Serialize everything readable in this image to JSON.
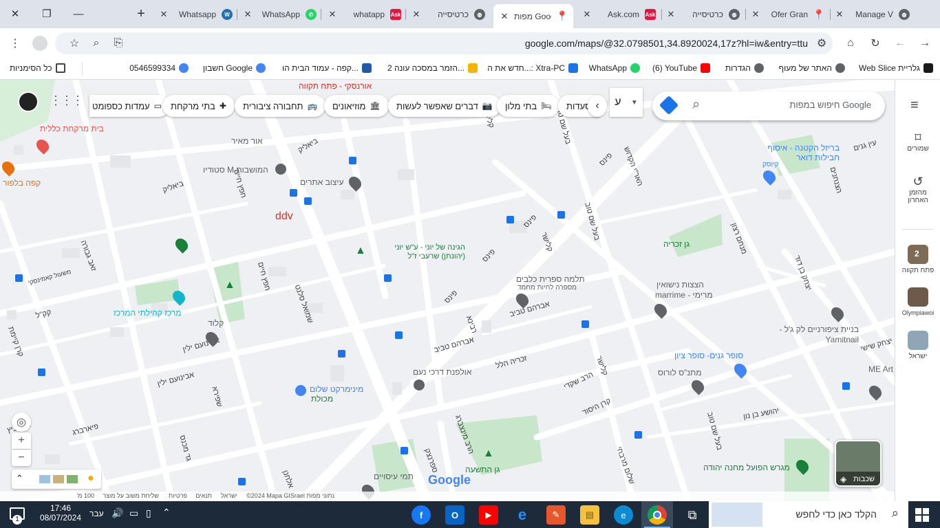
{
  "tabs": [
    {
      "title": "Whatsapp",
      "favicon": "wordpress-icon",
      "color": "#2271b1"
    },
    {
      "title": "WhatsApp",
      "favicon": "whatsapp-icon",
      "color": "#25d366"
    },
    {
      "title": "whatapp",
      "favicon": "ask-icon",
      "color": "#e3173e"
    },
    {
      "title": "כרטיסייה",
      "favicon": "globe-icon",
      "color": "#5f6368"
    },
    {
      "title": "מפות Google",
      "favicon": "maps-pin-icon",
      "color": "#34a853"
    },
    {
      "title": "Ask.com",
      "favicon": "ask-icon",
      "color": "#e3173e"
    },
    {
      "title": "כרטיסייה",
      "favicon": "globe-icon",
      "color": "#5f6368"
    },
    {
      "title": "Ofer Gran",
      "favicon": "maps-pin-icon",
      "color": "#34a853"
    },
    {
      "title": "Manage V",
      "favicon": "globe-icon",
      "color": "#5f6368"
    }
  ],
  "address": {
    "url": "google.com/maps/@32.0798501,34.8920024,17z?hl=iw&entry=ttu"
  },
  "bookmarks": [
    {
      "label": "Web Slice גלריית",
      "icon": "web-slice-icon",
      "color": "#1a1a1a"
    },
    {
      "label": "האתר של מעוף",
      "icon": "globe-icon",
      "color": "#5f6368"
    },
    {
      "label": "הגדרות",
      "icon": "gear-icon",
      "color": "#5f6368"
    },
    {
      "label": "(6) YouTube",
      "icon": "youtube-icon",
      "color": "#ff0000"
    },
    {
      "label": "WhatsApp",
      "icon": "whatsapp-icon",
      "color": "#25d366"
    },
    {
      "label": "חדש את ה...: Xtra-PC",
      "icon": "xtra-icon",
      "color": "#1a73e8"
    },
    {
      "label": "הזמר במסכה עונה 2...",
      "icon": "image-icon",
      "color": "#f4b400"
    },
    {
      "label": "קפה - עמוד הבית הו...",
      "icon": "k-icon",
      "color": "#1e5aa8"
    },
    {
      "label": "חשבון Google",
      "icon": "google-icon",
      "color": "#4285f4"
    },
    {
      "label": "0546599334",
      "icon": "google-icon",
      "color": "#4285f4"
    },
    {
      "label": "כל הסימניות",
      "icon": "folder-icon",
      "color": "#444"
    }
  ],
  "map": {
    "search_placeholder": "חיפוש במפות Google",
    "chips": [
      "עמדות כספומט",
      "בתי מרקחת",
      "תחבורה ציבורית",
      "מוזיאונים",
      "דברים שאפשר לעשות",
      "בתי מלון",
      "סעדות"
    ],
    "layers_label": "שכבות",
    "places": [
      {
        "name": "בית מרקחת כללית",
        "color": "#e8544e"
      },
      {
        "name": "קפה בלפור",
        "color": "#e8710a"
      },
      {
        "name": "אור מאיר",
        "color": "#5f6368"
      },
      {
        "name": "סטודיו M המושבות",
        "color": "#5f6368"
      },
      {
        "name": "עיצוב אתרים",
        "color": "#5f6368"
      },
      {
        "name": "ddv",
        "color": "#d93025"
      },
      {
        "name": "הגינה של יוני - ע\"ש יוני (יהונתן) שרעבי ז\"ל",
        "color": "#188038"
      },
      {
        "name": "מרכז קהילתי המרכז",
        "color": "#12b5cb"
      },
      {
        "name": "קלוד",
        "color": "#5f6368"
      },
      {
        "name": "תלמה ספרית כלבים",
        "color": "#5f6368"
      },
      {
        "name": "מספרה לחיות מחמד",
        "color": "#5f6368"
      },
      {
        "name": "גן זכריה",
        "color": "#188038"
      },
      {
        "name": "הצצות נישואין",
        "color": "#5f6368"
      },
      {
        "name": "marrime - מרימי",
        "color": "#5f6368"
      },
      {
        "name": "בריזל הקטנה - איסוף חבילות דואר",
        "color": "#4285f4"
      },
      {
        "name": "קיוסק",
        "color": "#4285f4"
      },
      {
        "name": "בניית ציפורניים לק ג'ל - Yamitnail",
        "color": "#5f6368"
      },
      {
        "name": "סופר גנים- סופר ציון",
        "color": "#4285f4"
      },
      {
        "name": "מתנ\"ס לורוס",
        "color": "#5f6368"
      },
      {
        "name": "אולפנת דרכי נעם",
        "color": "#5f6368"
      },
      {
        "name": "מינימרקט שלום",
        "color": "#4285f4"
      },
      {
        "name": "מכולת",
        "color": "#188038"
      },
      {
        "name": "גן התשעה",
        "color": "#188038"
      },
      {
        "name": "תמי עיסויים",
        "color": "#5f6368"
      },
      {
        "name": "מגרש הפועל מחנה יהודה",
        "color": "#188038"
      },
      {
        "name": "ME Art בניית",
        "color": "#5f6368"
      },
      {
        "name": "אורנסקי - פתח תקווה",
        "color": "#d93025"
      }
    ],
    "streets": [
      "ביאליק",
      "ביאליק",
      "שמואל סלנט",
      "חפץ חיים",
      "חפץ חיים",
      "שפירא",
      "זאב גבורה",
      "קק\"ל",
      "קרן קיימת",
      "פינס",
      "פינס",
      "פינס",
      "פינס",
      "בעל שם טוב",
      "בעל שם טוב",
      "בעל שם טוב",
      "קלישר",
      "קלישר",
      "קלישר",
      "מנחם רצון",
      "יצחק בן דוד",
      "הצנחנים",
      "האר\"י הקדוש",
      "אברהם טביב",
      "אברהם טביב",
      "זכריה הלל",
      "רבינא",
      "הרב שקדי",
      "קרן היסוד",
      "יהושע בן נון",
      "אבינועם ילין",
      "אבינועם ילין",
      "ספרנצק",
      "פיארברג",
      "אנילביץ",
      "גד מכנס",
      "משעול קאמינסקי",
      "אלחנן",
      "שלום מרבחי",
      "הרב מינצברג",
      "יצחק שישי",
      "עין גנים"
    ],
    "footer": [
      "נתוני מפות ‎©2024 Mapa GISrael",
      "ישראל",
      "תנאים",
      "פרטיות",
      "שליחת משוב על מוצר",
      "100 מ'"
    ],
    "google_logo": "Google"
  },
  "sidebar": {
    "saved": "שמורים",
    "recent_line1": "מהזמן",
    "recent_line2": "האחרון",
    "places": [
      {
        "label": "פתח תקווה",
        "badge": "2"
      },
      {
        "label": "Olympiawoi"
      },
      {
        "label": "ישראל"
      }
    ]
  },
  "taskbar": {
    "search_placeholder": "הקלד כאן כדי לחפש",
    "time": "17:46",
    "date": "08/07/2024",
    "lang": "עבר",
    "notif_count": "1"
  }
}
